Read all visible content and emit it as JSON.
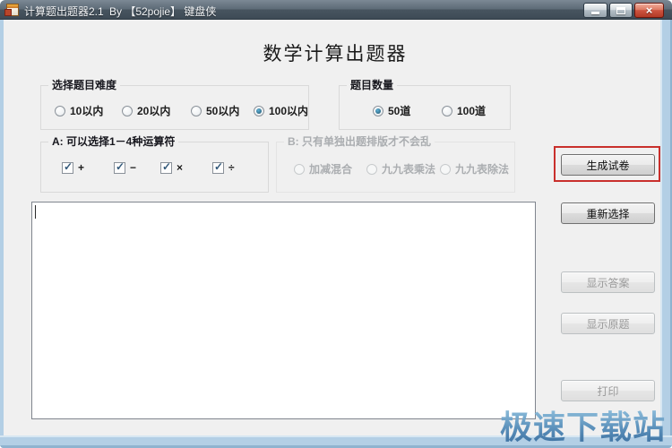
{
  "window": {
    "title": "计算题出题器2.1",
    "byline": "By 【52pojie】 键盘侠",
    "controls": {
      "close_glyph": "×"
    }
  },
  "header": {
    "title": "数学计算出题器"
  },
  "difficulty_group": {
    "label": "选择题目难度",
    "options": [
      {
        "label": "10以内",
        "selected": false
      },
      {
        "label": "20以内",
        "selected": false
      },
      {
        "label": "50以内",
        "selected": false
      },
      {
        "label": "100以内",
        "selected": true
      }
    ]
  },
  "quantity_group": {
    "label": "题目数量",
    "options": [
      {
        "label": "50道",
        "selected": true
      },
      {
        "label": "100道",
        "selected": false
      }
    ]
  },
  "operator_group": {
    "label": "A: 可以选择1－4种运算符",
    "options": [
      {
        "label": "+",
        "checked": true
      },
      {
        "label": "−",
        "checked": true
      },
      {
        "label": "×",
        "checked": true
      },
      {
        "label": "÷",
        "checked": true
      }
    ]
  },
  "mode_group": {
    "label": "B: 只有单独出题排版才不会乱",
    "disabled": true,
    "options": [
      {
        "label": "加减混合",
        "selected": false
      },
      {
        "label": "九九表乘法",
        "selected": false
      },
      {
        "label": "九九表除法",
        "selected": false
      }
    ]
  },
  "output_area": {
    "value": ""
  },
  "buttons": {
    "generate": "生成试卷",
    "reselect": "重新选择",
    "show_answers": "显示答案",
    "show_original": "显示原题",
    "print": "打印"
  },
  "watermark": {
    "text": "极速下载站"
  },
  "colors": {
    "highlight_box": "#c9302c",
    "titlebar": "#4d5a66",
    "window_border": "#b3cfe5",
    "client_background": "#f0f0f0"
  }
}
